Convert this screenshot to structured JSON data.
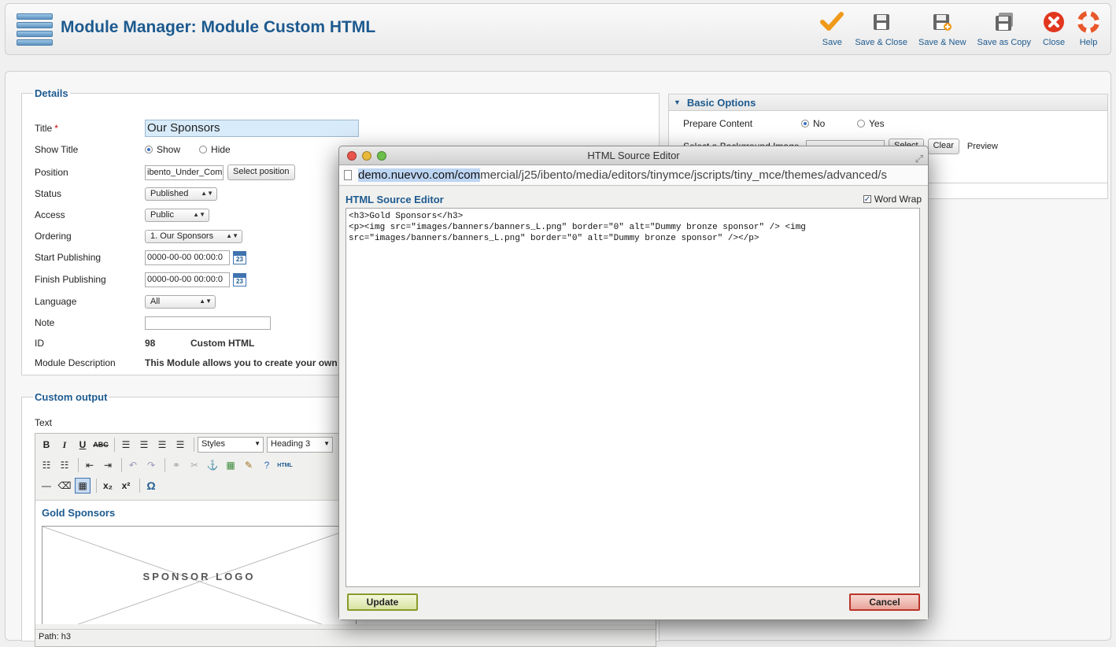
{
  "header": {
    "title": "Module Manager: Module Custom HTML",
    "toolbar": [
      {
        "label": "Save",
        "icon": "checkmark-icon"
      },
      {
        "label": "Save & Close",
        "icon": "save-icon"
      },
      {
        "label": "Save & New",
        "icon": "save-new-icon"
      },
      {
        "label": "Save as Copy",
        "icon": "save-copy-icon"
      },
      {
        "label": "Close",
        "icon": "close-icon"
      },
      {
        "label": "Help",
        "icon": "lifebuoy-icon"
      }
    ]
  },
  "details": {
    "legend": "Details",
    "title_label": "Title",
    "title_required": "*",
    "title_value": "Our Sponsors",
    "show_title_label": "Show Title",
    "show_option": "Show",
    "hide_option": "Hide",
    "position_label": "Position",
    "position_value": "ibento_Under_Comp",
    "select_position_button": "Select position",
    "status_label": "Status",
    "status_value": "Published",
    "access_label": "Access",
    "access_value": "Public",
    "ordering_label": "Ordering",
    "ordering_value": "1. Our Sponsors",
    "start_publishing_label": "Start Publishing",
    "start_publishing_value": "0000-00-00 00:00:0",
    "finish_publishing_label": "Finish Publishing",
    "finish_publishing_value": "0000-00-00 00:00:0",
    "calendar_day": "23",
    "language_label": "Language",
    "language_value": "All",
    "note_label": "Note",
    "note_value": "",
    "id_label": "ID",
    "id_value": "98",
    "module_type": "Custom HTML",
    "description_label": "Module Description",
    "description_value": "This Module allows you to create your own H"
  },
  "custom_output": {
    "legend": "Custom output",
    "text_label": "Text",
    "styles_select": "Styles",
    "format_select": "Heading 3",
    "html_button": "HTML",
    "content_heading": "Gold Sponsors",
    "sponsor_logo_text": "SPONSOR LOGO",
    "path_text": "Path: h3"
  },
  "basic_options": {
    "title": "Basic Options",
    "prepare_content_label": "Prepare Content",
    "no_option": "No",
    "yes_option": "Yes",
    "background_label": "Select a Background Image",
    "select_button": "Select",
    "clear_button": "Clear",
    "preview_label": "Preview"
  },
  "popup": {
    "window_title": "HTML Source Editor",
    "url_highlight": "demo.nuevvo.com/com",
    "url_rest": "mercial/j25/ibento/media/editors/tinymce/jscripts/tiny_mce/themes/advanced/s",
    "editor_title": "HTML Source Editor",
    "word_wrap_label": "Word Wrap",
    "source_code": "<h3>Gold Sponsors</h3>\n<p><img src=\"images/banners/banners_L.png\" border=\"0\" alt=\"Dummy bronze sponsor\" /> <img\nsrc=\"images/banners/banners_L.png\" border=\"0\" alt=\"Dummy bronze sponsor\" /></p>",
    "update_button": "Update",
    "cancel_button": "Cancel"
  },
  "colors": {
    "accent": "#1d5a8f",
    "update_border": "#8a9a2a",
    "cancel_border": "#b9342a"
  }
}
